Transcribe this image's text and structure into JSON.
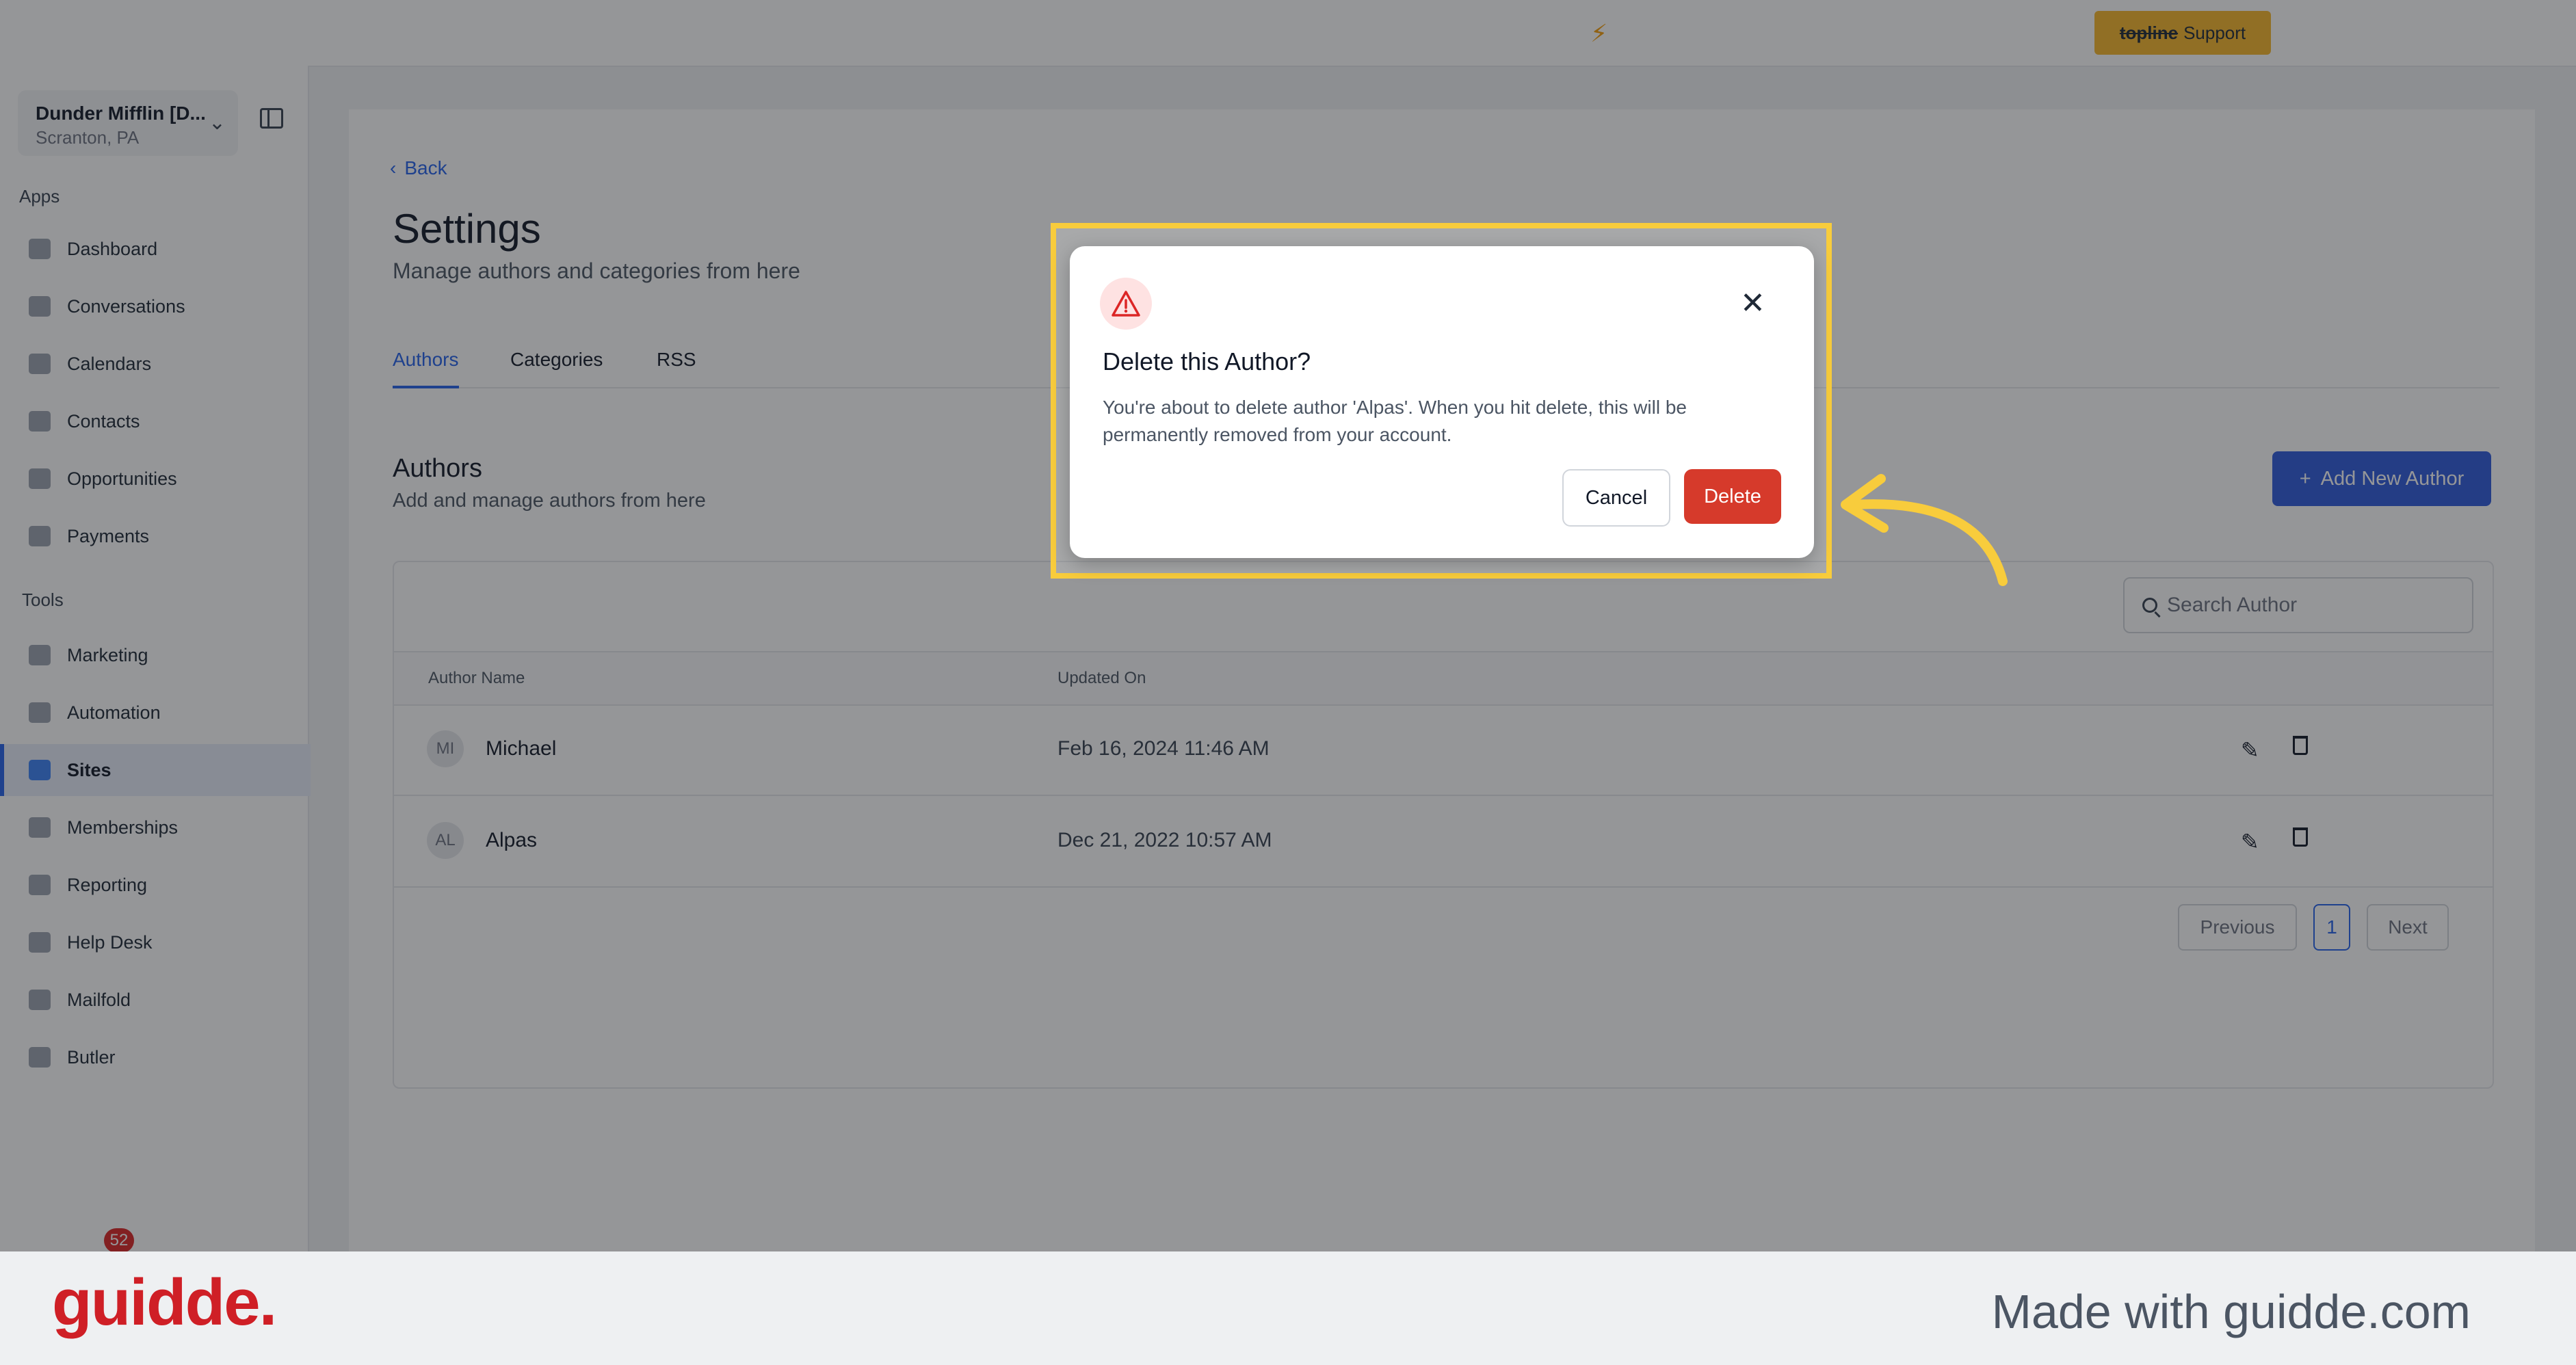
{
  "topbar": {
    "support_brand": "topline",
    "support_label": "Support"
  },
  "sidebar": {
    "account_name": "Dunder Mifflin [D...",
    "account_location": "Scranton, PA",
    "apps_label": "Apps",
    "tools_label": "Tools",
    "apps": [
      {
        "label": "Dashboard"
      },
      {
        "label": "Conversations"
      },
      {
        "label": "Calendars"
      },
      {
        "label": "Contacts"
      },
      {
        "label": "Opportunities"
      },
      {
        "label": "Payments"
      }
    ],
    "tools": [
      {
        "label": "Marketing"
      },
      {
        "label": "Automation"
      },
      {
        "label": "Sites"
      },
      {
        "label": "Memberships"
      },
      {
        "label": "Reporting"
      },
      {
        "label": "Help Desk"
      },
      {
        "label": "Mailfold"
      },
      {
        "label": "Butler"
      }
    ],
    "notification_count": "52"
  },
  "main": {
    "back_label": "Back",
    "title": "Settings",
    "subtitle": "Manage authors and categories from here",
    "tabs": [
      {
        "label": "Authors"
      },
      {
        "label": "Categories"
      },
      {
        "label": "RSS"
      }
    ],
    "section_title": "Authors",
    "section_subtitle": "Add and manage authors from here",
    "add_button": "Add New Author",
    "search_placeholder": "Search Author",
    "columns": [
      "Author Name",
      "Updated On"
    ],
    "rows": [
      {
        "initials": "MI",
        "name": "Michael",
        "updated": "Feb 16, 2024 11:46 AM"
      },
      {
        "initials": "AL",
        "name": "Alpas",
        "updated": "Dec 21, 2022 10:57 AM"
      }
    ],
    "pagination": {
      "previous": "Previous",
      "page": "1",
      "next": "Next"
    }
  },
  "dialog": {
    "title": "Delete this Author?",
    "message": "You're about to delete author 'Alpas'. When you hit delete, this will be permanently removed from your account.",
    "cancel_label": "Cancel",
    "delete_label": "Delete"
  },
  "footer": {
    "logo": "guidde.",
    "made_with": "Made with guidde.com"
  },
  "colors": {
    "highlight": "#f8cc3c",
    "danger": "#d63a2b",
    "primary": "#2f5bdc",
    "brand_logo": "#cf1f26"
  }
}
